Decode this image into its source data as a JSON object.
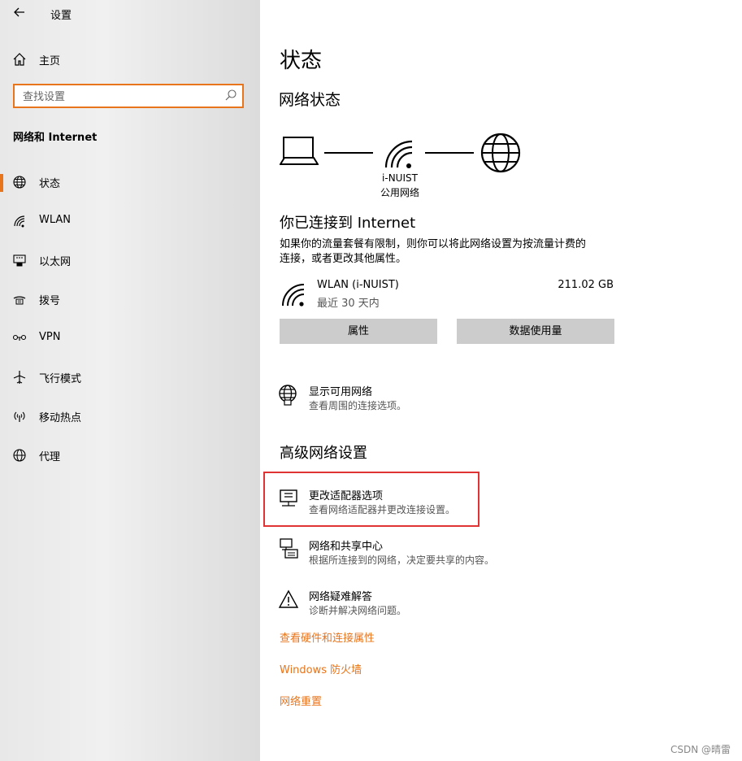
{
  "header": {
    "title": "设置"
  },
  "sidebar": {
    "home_label": "主页",
    "search_placeholder": "查找设置",
    "section_title": "网络和 Internet",
    "items": [
      {
        "label": "状态",
        "icon": "globe-network-icon",
        "active": true
      },
      {
        "label": "WLAN",
        "icon": "wifi-icon"
      },
      {
        "label": "以太网",
        "icon": "ethernet-icon"
      },
      {
        "label": "拨号",
        "icon": "dialup-icon"
      },
      {
        "label": "VPN",
        "icon": "vpn-icon"
      },
      {
        "label": "飞行模式",
        "icon": "airplane-icon"
      },
      {
        "label": "移动热点",
        "icon": "hotspot-icon"
      },
      {
        "label": "代理",
        "icon": "globe-icon"
      }
    ]
  },
  "main": {
    "page_title": "状态",
    "network_status_heading": "网络状态",
    "network_name": "i-NUIST",
    "network_type": "公用网络",
    "connected_heading": "你已连接到 Internet",
    "connected_desc_line1": "如果你的流量套餐有限制，则你可以将此网络设置为按流量计费的",
    "connected_desc_line2": "连接，或者更改其他属性。",
    "usage": {
      "name": "WLAN (i-NUIST)",
      "period": "最近 30 天内",
      "amount": "211.02 GB"
    },
    "buttons": {
      "properties": "属性",
      "data_usage": "数据使用量"
    },
    "show_networks": {
      "title": "显示可用网络",
      "desc": "查看周围的连接选项。"
    },
    "advanced_heading": "高级网络设置",
    "adapter_options": {
      "title": "更改适配器选项",
      "desc": "查看网络适配器并更改连接设置。"
    },
    "sharing_center": {
      "title": "网络和共享中心",
      "desc": "根据所连接到的网络，决定要共享的内容。"
    },
    "troubleshooter": {
      "title": "网络疑难解答",
      "desc": "诊断并解决网络问题。"
    },
    "links": {
      "hardware": "查看硬件和连接属性",
      "firewall": "Windows 防火墙",
      "reset": "网络重置"
    }
  },
  "watermark": "CSDN @晴雷",
  "colors": {
    "accent": "#e8741c",
    "highlight_box": "#e03434",
    "button_bg": "#cccccc"
  }
}
